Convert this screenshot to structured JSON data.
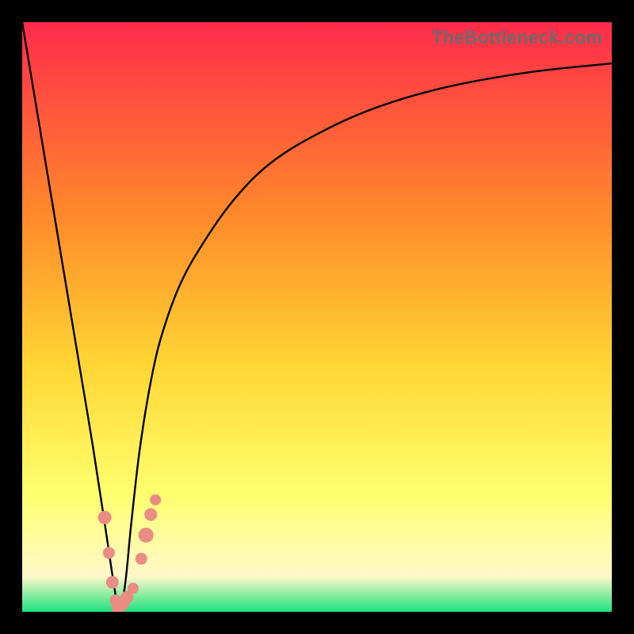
{
  "watermark": "TheBottleneck.com",
  "colors": {
    "black": "#000000",
    "curve": "#000000",
    "marker_fill": "#e98c84",
    "marker_stroke": "#cc6a62",
    "grad_top": "#ff2b4b",
    "grad_mid1": "#ff8a2a",
    "grad_mid2": "#ffd633",
    "grad_mid3": "#ffff6e",
    "grad_pale": "#fff8c9",
    "grad_green": "#1de27f"
  },
  "chart_data": {
    "type": "line",
    "title": "",
    "xlabel": "",
    "ylabel": "",
    "xlim": [
      0,
      100
    ],
    "ylim": [
      0,
      100
    ],
    "series": [
      {
        "name": "bottleneck-curve",
        "x": [
          0,
          2,
          5,
          8,
          10,
          12,
          14,
          15.5,
          16.5,
          17.5,
          18.5,
          20,
          22,
          24,
          27,
          31,
          36,
          42,
          50,
          60,
          72,
          86,
          100
        ],
        "y": [
          100,
          88,
          70,
          52,
          40,
          28,
          15,
          5,
          0,
          5,
          15,
          28,
          40,
          48,
          56,
          63,
          70,
          76,
          81,
          85.5,
          89,
          91.5,
          93
        ]
      }
    ],
    "markers": [
      {
        "x": 14.0,
        "y": 16.0,
        "r": 8.5
      },
      {
        "x": 14.7,
        "y": 10.0,
        "r": 7.5
      },
      {
        "x": 15.3,
        "y": 5.0,
        "r": 8.0
      },
      {
        "x": 15.8,
        "y": 2.0,
        "r": 7.0
      },
      {
        "x": 16.3,
        "y": 0.8,
        "r": 9.0
      },
      {
        "x": 17.0,
        "y": 1.5,
        "r": 9.0
      },
      {
        "x": 17.8,
        "y": 2.5,
        "r": 8.0
      },
      {
        "x": 18.8,
        "y": 4.0,
        "r": 7.0
      },
      {
        "x": 20.2,
        "y": 9.0,
        "r": 7.5
      },
      {
        "x": 21.0,
        "y": 13.0,
        "r": 9.5
      },
      {
        "x": 21.8,
        "y": 16.5,
        "r": 8.0
      },
      {
        "x": 22.6,
        "y": 19.0,
        "r": 7.0
      }
    ]
  }
}
